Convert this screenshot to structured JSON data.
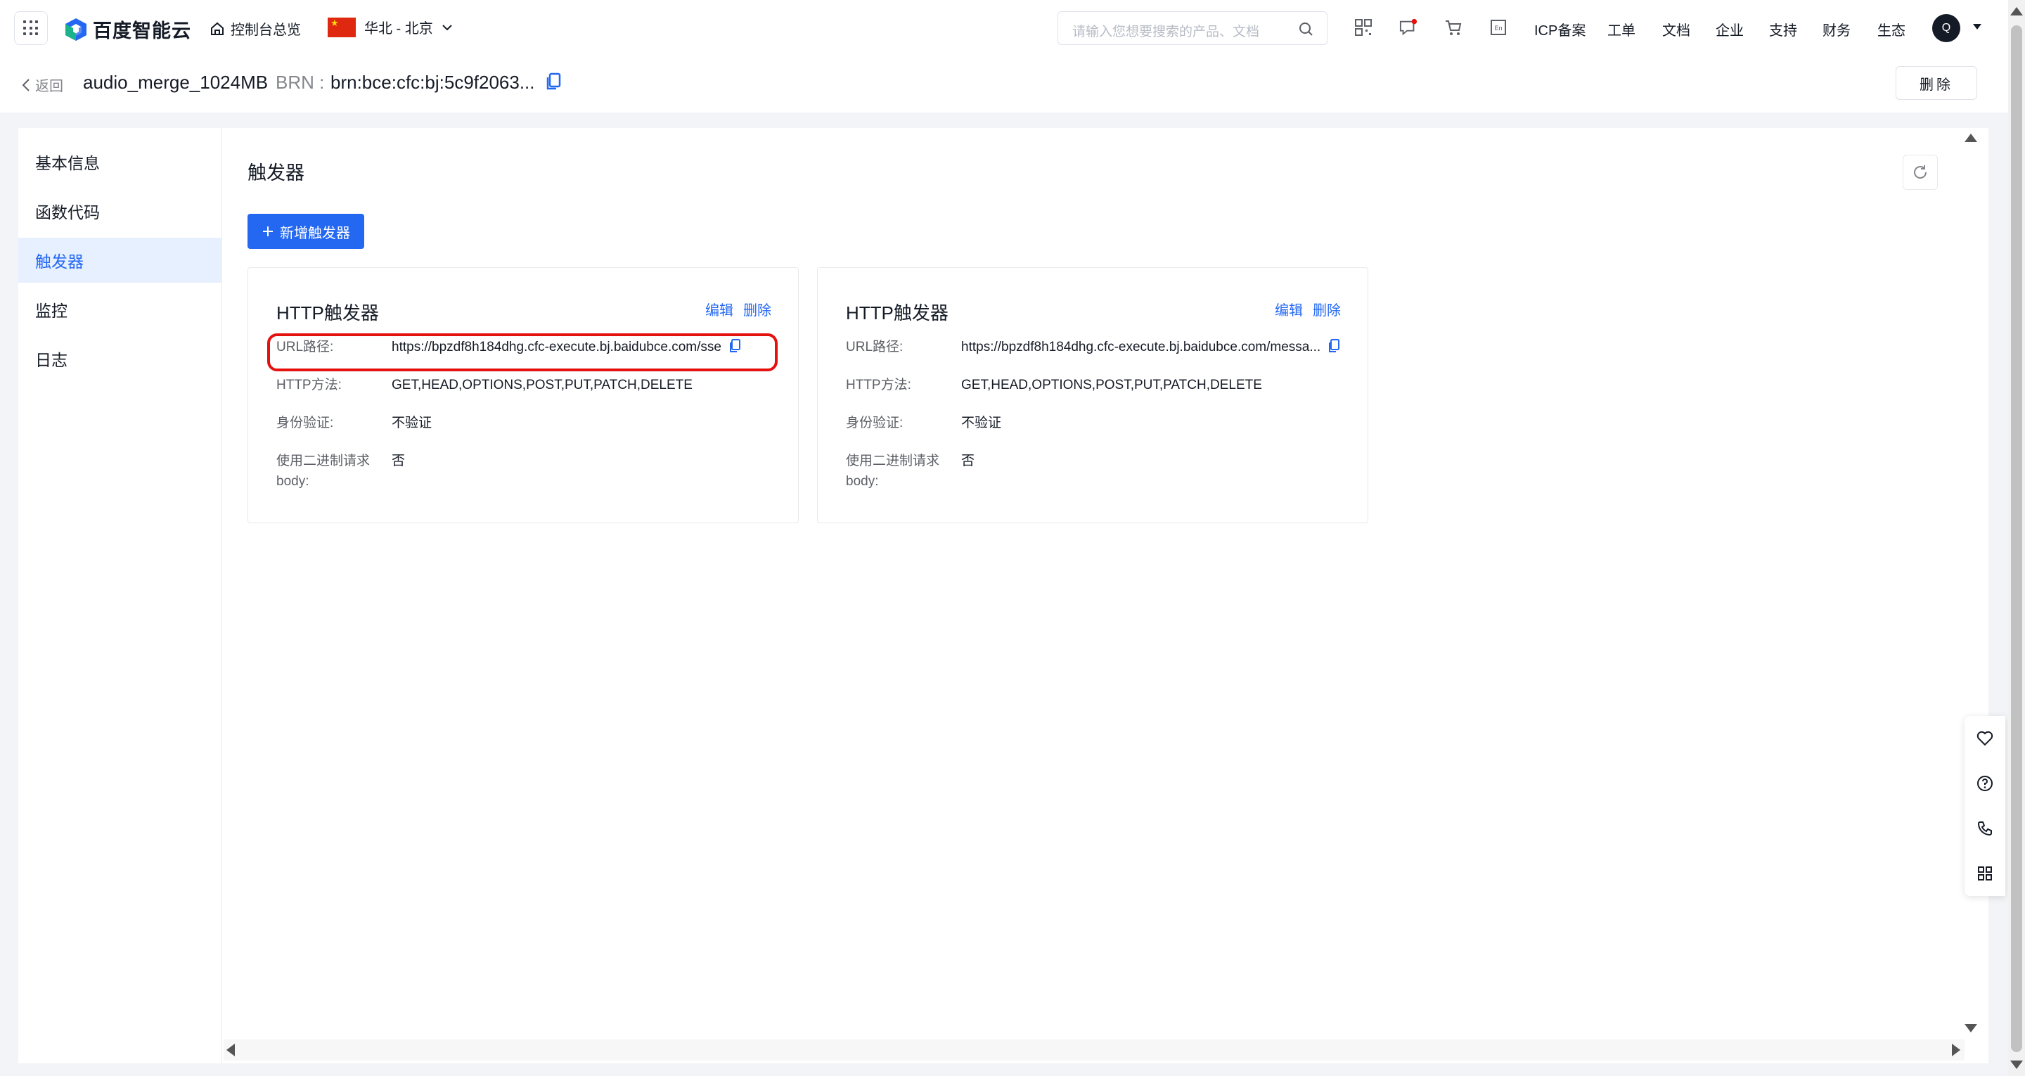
{
  "topnav": {
    "logo_text": "百度智能云",
    "home_label": "控制台总览",
    "region_label": "华北 - 北京",
    "search_placeholder": "请输入您想要搜索的产品、文档",
    "links": [
      "ICP备案",
      "工单",
      "文档",
      "企业",
      "支持",
      "财务",
      "生态"
    ],
    "avatar_letter": "Q"
  },
  "subheader": {
    "back_label": "返回",
    "function_name": "audio_merge_1024MB",
    "brn_label": "BRN :",
    "brn_value": "brn:bce:cfc:bj:5c9f2063...",
    "delete_label": "删除"
  },
  "sidebar": {
    "items": [
      {
        "label": "基本信息"
      },
      {
        "label": "函数代码"
      },
      {
        "label": "触发器"
      },
      {
        "label": "监控"
      },
      {
        "label": "日志"
      }
    ],
    "active_index": 2
  },
  "content": {
    "title": "触发器",
    "add_button": "新增触发器"
  },
  "cards": [
    {
      "title": "HTTP触发器",
      "edit": "编辑",
      "delete": "删除",
      "url_label": "URL路径:",
      "url_value": "https://bpzdf8h184dhg.cfc-execute.bj.baidubce.com/sse",
      "method_label": "HTTP方法:",
      "method_value": "GET,HEAD,OPTIONS,POST,PUT,PATCH,DELETE",
      "auth_label": "身份验证:",
      "auth_value": "不验证",
      "binary_label_1": "使用二进制请求",
      "binary_label_2": "body:",
      "binary_value": "否"
    },
    {
      "title": "HTTP触发器",
      "edit": "编辑",
      "delete": "删除",
      "url_label": "URL路径:",
      "url_value": "https://bpzdf8h184dhg.cfc-execute.bj.baidubce.com/messa...",
      "method_label": "HTTP方法:",
      "method_value": "GET,HEAD,OPTIONS,POST,PUT,PATCH,DELETE",
      "auth_label": "身份验证:",
      "auth_value": "不验证",
      "binary_label_1": "使用二进制请求",
      "binary_label_2": "body:",
      "binary_value": "否"
    }
  ],
  "colors": {
    "accent": "#2468f2",
    "highlight_border": "#e4110f",
    "active_bg": "#e6f0ff"
  },
  "icons": [
    "apps-grid-icon",
    "home-icon",
    "china-flag-icon",
    "chevron-down-icon",
    "search-icon",
    "qrcode-icon",
    "message-icon",
    "cart-icon",
    "language-icon",
    "copy-icon",
    "refresh-icon",
    "plus-icon",
    "heart-icon",
    "help-icon",
    "phone-icon",
    "apps-icon"
  ]
}
